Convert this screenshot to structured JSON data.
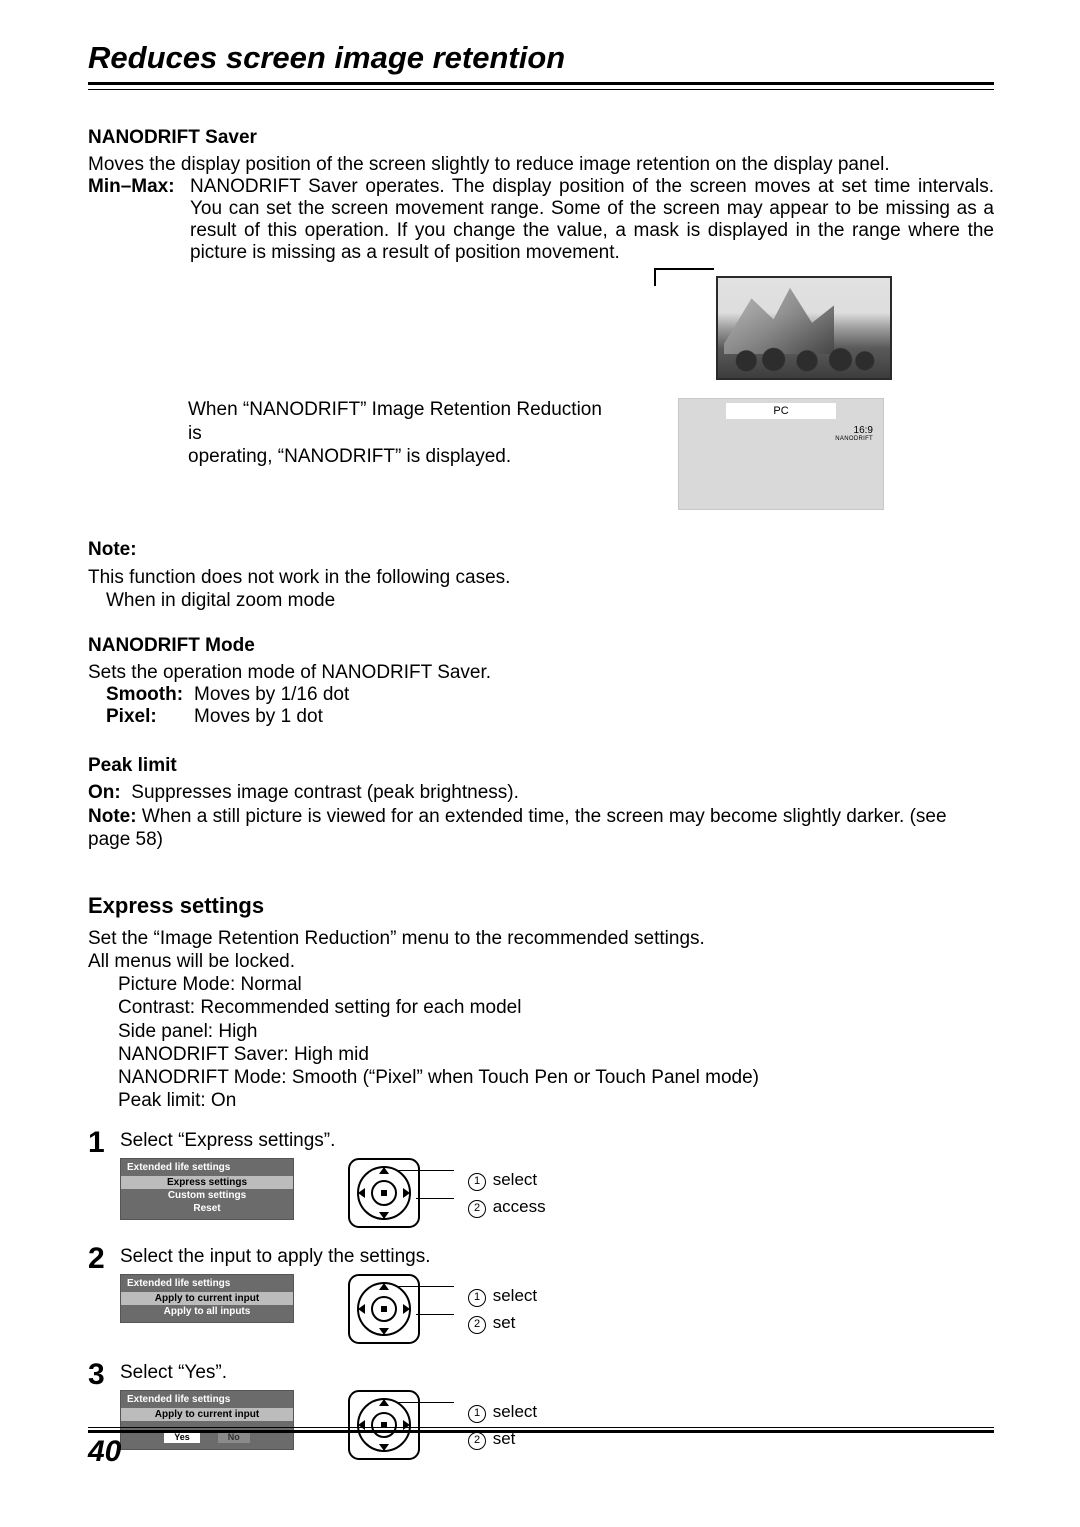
{
  "page": {
    "number": "40",
    "title": "Reduces screen image retention"
  },
  "nanodrift_saver": {
    "heading": "NANODRIFT Saver",
    "intro": "Moves the display position of the screen slightly to reduce image retention on the display panel.",
    "minmax_label": "Min–Max:",
    "minmax_body": "NANODRIFT Saver operates. The display position of the screen moves at set time intervals. You can set the screen movement range. Some of the screen may appear to be missing as a result of this operation. If you change the value, a mask is displayed in the range where the picture is missing as a result of position movement.",
    "operating_text_1": "When “NANODRIFT” Image Retention Reduction is",
    "operating_text_2": "operating, “NANODRIFT” is displayed.",
    "osd": {
      "input": "PC",
      "aspect": "16:9",
      "tag": "NANODRIFT"
    }
  },
  "note": {
    "label": "Note:",
    "line1": "This function does not work in the following cases.",
    "line2": "When in digital zoom mode"
  },
  "nanodrift_mode": {
    "heading": "NANODRIFT Mode",
    "intro": "Sets the operation mode of NANODRIFT Saver.",
    "smooth_label": "Smooth:",
    "smooth_text": "Moves by 1/16 dot",
    "pixel_label": "Pixel:",
    "pixel_text": "Moves by 1 dot"
  },
  "peak_limit": {
    "heading": "Peak limit",
    "on_label": "On:",
    "on_text": "Suppresses image contrast (peak brightness).",
    "note_label": "Note:",
    "note_text": "When a still picture is viewed for an extended time, the screen may become slightly darker. (see page 58)"
  },
  "express": {
    "heading": "Express settings",
    "intro1": "Set the “Image Retention Reduction” menu to the recommended settings.",
    "intro2": "All menus will be locked.",
    "lines": [
      "Picture Mode: Normal",
      "Contrast: Recommended setting for each model",
      "Side panel: High",
      "NANODRIFT Saver: High mid",
      "NANODRIFT Mode: Smooth (“Pixel” when Touch Pen or Touch Panel mode)",
      "Peak limit: On"
    ],
    "steps": [
      {
        "num": "1",
        "text": "Select “Express settings”.",
        "menu": {
          "title": "Extended life settings",
          "items": [
            "Express settings",
            "Custom settings",
            "Reset"
          ],
          "hl": 0
        },
        "joy": [
          "select",
          "access"
        ]
      },
      {
        "num": "2",
        "text": "Select the input to apply the settings.",
        "menu": {
          "title": "Extended life settings",
          "items": [
            "Apply to current input",
            "Apply to all inputs"
          ],
          "hl": 0
        },
        "joy": [
          "select",
          "set"
        ]
      },
      {
        "num": "3",
        "text": "Select “Yes”.",
        "menu": {
          "title": "Extended life settings",
          "items": [
            "Apply to current input"
          ],
          "hl": 0,
          "buttons": [
            "Yes",
            "No"
          ],
          "btn_hl": 0
        },
        "joy": [
          "select",
          "set"
        ]
      }
    ]
  }
}
